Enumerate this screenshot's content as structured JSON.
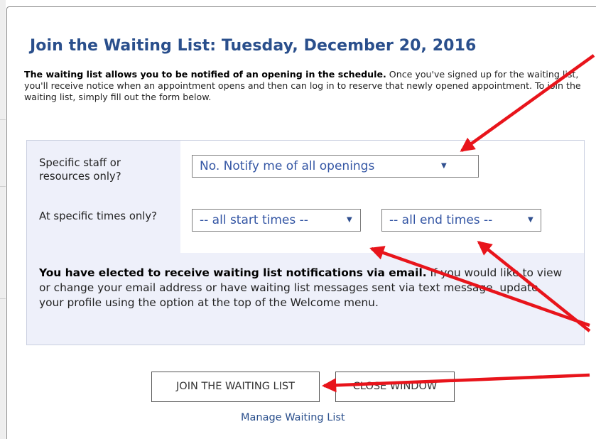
{
  "dialog": {
    "title": "Join the Waiting List: Tuesday, December 20, 2016",
    "intro_bold": "The waiting list allows you to be notified of an opening in the schedule.",
    "intro_text": " Once you've signed up for the waiting list, you'll receive notice when an appointment opens and then can log in to reserve that newly opened appointment. To join the waiting list, simply fill out the form below."
  },
  "form": {
    "staff_label": "Specific staff or resources only?",
    "staff_selected": "No. Notify me of all openings",
    "times_label": "At specific times only?",
    "start_selected": "-- all start times --",
    "end_selected": "-- all end times --",
    "notice_bold": "You have elected to receive waiting list notifications via email.",
    "notice_text": " If you would like to view or change your email address or have waiting list messages sent via text message, update your profile using the option at the top of the Welcome menu."
  },
  "buttons": {
    "join_label": "JOIN THE WAITING LIST",
    "close_label": "CLOSE WINDOW"
  },
  "links": {
    "manage_label": "Manage Waiting List"
  },
  "icons": {
    "dropdown_caret": "▼"
  },
  "colors": {
    "title": "#2a4f8c",
    "form_background": "#eef0fa",
    "annotation_arrow": "#e8141b"
  }
}
